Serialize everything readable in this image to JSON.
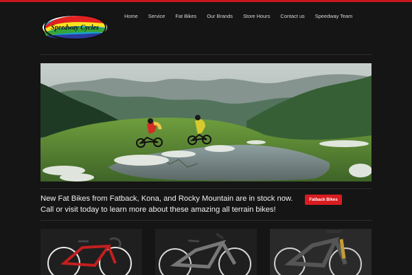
{
  "brand": {
    "logo_text": "Speedway Cycles"
  },
  "nav": {
    "items": [
      "Home",
      "Service",
      "Fat Bikes",
      "Our Brands",
      "Store Hours",
      "Contact us",
      "Speedway Team"
    ]
  },
  "promo": {
    "text": "New Fat Bikes from Fatback, Kona, and Rocky Mountain are in stock now. Call or visit today to learn more about these amazing all terrain bikes!",
    "button_label": "Fatback Bikes"
  },
  "colors": {
    "background": "#151515",
    "accent": "#d81c20",
    "nav_text": "#d8d8d8"
  }
}
